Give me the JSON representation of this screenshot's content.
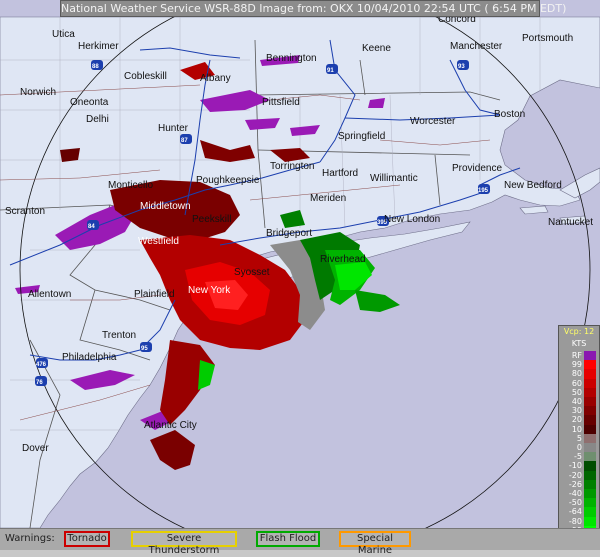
{
  "title": "National Weather Service WSR-88D Image from: OKX 10/04/2010 22:54 UTC ( 6:54 PM EDT)",
  "cities": [
    {
      "name": "Utica"
    },
    {
      "name": "Herkimer"
    },
    {
      "name": "Concord"
    },
    {
      "name": "Cobleskill"
    },
    {
      "name": "Albany"
    },
    {
      "name": "Bennington"
    },
    {
      "name": "Keene"
    },
    {
      "name": "Manchester"
    },
    {
      "name": "Portsmouth"
    },
    {
      "name": "Norwich"
    },
    {
      "name": "Oneonta"
    },
    {
      "name": "Delhi"
    },
    {
      "name": "Pittsfield"
    },
    {
      "name": "Hunter"
    },
    {
      "name": "Springfield"
    },
    {
      "name": "Worcester"
    },
    {
      "name": "Boston"
    },
    {
      "name": "Torrington"
    },
    {
      "name": "Hartford"
    },
    {
      "name": "Willimantic"
    },
    {
      "name": "Providence"
    },
    {
      "name": "Monticello"
    },
    {
      "name": "Poughkeepsie"
    },
    {
      "name": "New Bedford"
    },
    {
      "name": "Middletown"
    },
    {
      "name": "Meriden"
    },
    {
      "name": "Scranton"
    },
    {
      "name": "Peekskill"
    },
    {
      "name": "New London"
    },
    {
      "name": "Nantucket"
    },
    {
      "name": "Westfield"
    },
    {
      "name": "Bridgeport"
    },
    {
      "name": "Riverhead"
    },
    {
      "name": "Syosset"
    },
    {
      "name": "Allentown"
    },
    {
      "name": "Plainfield"
    },
    {
      "name": "New York"
    },
    {
      "name": "Trenton"
    },
    {
      "name": "Philadelphia"
    },
    {
      "name": "Dover"
    },
    {
      "name": "Atlantic City"
    }
  ],
  "legend": {
    "header_mode": "Vcp: 12",
    "header_units": "KTS",
    "rows": [
      {
        "label": "RF",
        "color": "#8a18b0"
      },
      {
        "label": "99",
        "color": "#ff0000"
      },
      {
        "label": "80",
        "color": "#e60000"
      },
      {
        "label": "60",
        "color": "#cc0000"
      },
      {
        "label": "50",
        "color": "#b30000"
      },
      {
        "label": "40",
        "color": "#990000"
      },
      {
        "label": "30",
        "color": "#7f0000"
      },
      {
        "label": "20",
        "color": "#660000"
      },
      {
        "label": "10",
        "color": "#4d0000"
      },
      {
        "label": "5",
        "color": "#8f6f6f"
      },
      {
        "label": "0",
        "color": "#888888"
      },
      {
        "label": "-5",
        "color": "#6f8f6f"
      },
      {
        "label": "-10",
        "color": "#004d00"
      },
      {
        "label": "-20",
        "color": "#006600"
      },
      {
        "label": "-26",
        "color": "#008000"
      },
      {
        "label": "-40",
        "color": "#009900"
      },
      {
        "label": "-50",
        "color": "#00b300"
      },
      {
        "label": "-64",
        "color": "#00cc00"
      },
      {
        "label": "-80",
        "color": "#00e600"
      },
      {
        "label": "-99",
        "color": "#00ff00"
      },
      {
        "label": "ND",
        "color": "#666666"
      }
    ]
  },
  "warnings": {
    "label": "Warnings:",
    "items": [
      {
        "name": "Tornado",
        "border": "#cc0000"
      },
      {
        "name": "Severe Thunderstorm",
        "border": "#e6d000"
      },
      {
        "name": "Flash Flood",
        "border": "#00aa00"
      },
      {
        "name": "Special Marine",
        "border": "#ff9900"
      }
    ]
  },
  "highways": [
    "88",
    "91",
    "93",
    "87",
    "84",
    "95",
    "395",
    "195",
    "76",
    "476"
  ],
  "colors": {
    "land": "#dfe6f4",
    "water": "#c2c2de",
    "range_ring": "#111111"
  }
}
